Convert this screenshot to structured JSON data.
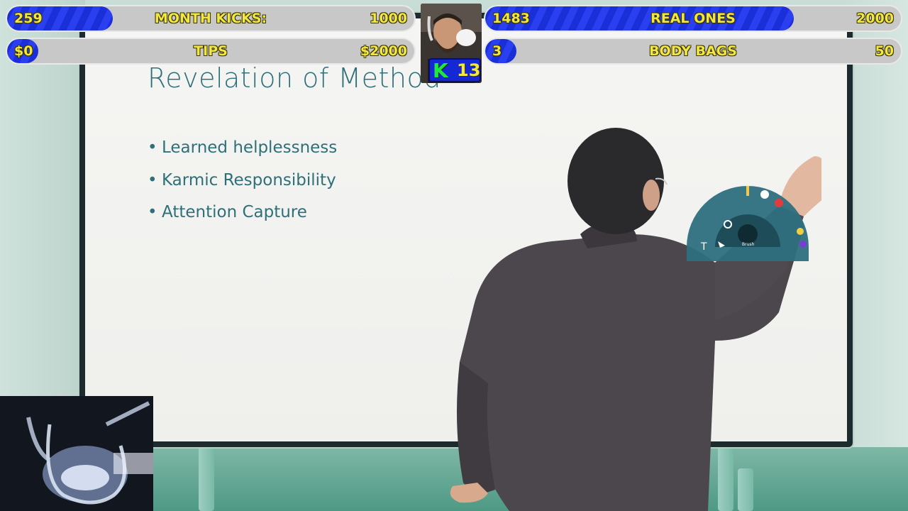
{
  "slide": {
    "title": "Revelation of Method",
    "bullets": [
      "Learned helplessness",
      "Karmic Responsibility",
      "Attention Capture"
    ]
  },
  "overlay": {
    "bars": [
      {
        "id": "month-kicks",
        "value": "259",
        "label": "MONTH KICKS:",
        "goal": "1000",
        "progress": 0.259
      },
      {
        "id": "tips",
        "value": "$0",
        "label": "TIPS",
        "goal": "$2000",
        "progress": 0.0
      },
      {
        "id": "real-ones",
        "value": "1483",
        "label": "REAL ONES",
        "goal": "2000",
        "progress": 0.7415
      },
      {
        "id": "body-bags",
        "value": "3",
        "label": "BODY BAGS",
        "goal": "50",
        "progress": 0.06
      }
    ],
    "k_badge": {
      "letter": "K",
      "count": "13"
    }
  },
  "tool_dial": {
    "icons": [
      "text-tool-icon",
      "select-arrow-icon",
      "search-icon",
      "brush-icon",
      "pen-icon"
    ],
    "center_label": "Brush"
  },
  "colors": {
    "bar_fill": "#1b2fd8",
    "bar_text": "#f2e640",
    "k_green": "#1ee840",
    "slide_text": "#2f6f78"
  }
}
